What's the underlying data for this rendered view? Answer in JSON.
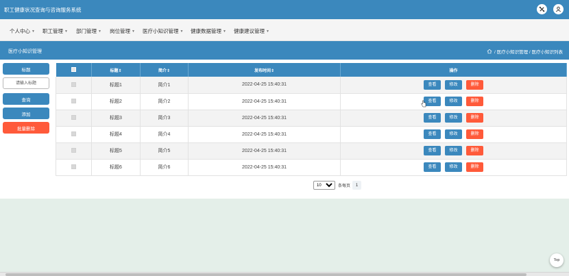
{
  "app": {
    "title": "职工健康状况查询与咨询服务系统"
  },
  "topbar": {
    "icons": [
      "settings-tool-icon",
      "user-icon"
    ]
  },
  "nav": {
    "items": [
      {
        "label": "个人中心"
      },
      {
        "label": "职工管理"
      },
      {
        "label": "部门管理"
      },
      {
        "label": "岗位管理"
      },
      {
        "label": "医疗小知识管理"
      },
      {
        "label": "健康数据管理"
      },
      {
        "label": "健康建议管理"
      }
    ]
  },
  "subheader": {
    "title": "医疗小知识管理",
    "breadcrumb": " / 医疗小知识管理 / 医疗小知识列表"
  },
  "sidebar": {
    "field_label": "标题",
    "input_placeholder": "请输入标题",
    "query_label": "查询",
    "add_label": "添加",
    "batch_delete_label": "批量删除"
  },
  "table": {
    "headers": {
      "title": "标题⇕",
      "summary": "简介⇕",
      "publish_time": "发布时间⇕",
      "actions": "操作"
    },
    "rows": [
      {
        "title": "标题1",
        "summary": "简介1",
        "publish_time": "2022-04-25 15:40:31"
      },
      {
        "title": "标题2",
        "summary": "简介2",
        "publish_time": "2022-04-25 15:40:31"
      },
      {
        "title": "标题3",
        "summary": "简介3",
        "publish_time": "2022-04-25 15:40:31"
      },
      {
        "title": "标题4",
        "summary": "简介4",
        "publish_time": "2022-04-25 15:40:31"
      },
      {
        "title": "标题5",
        "summary": "简介5",
        "publish_time": "2022-04-25 15:40:31"
      },
      {
        "title": "标题6",
        "summary": "简介6",
        "publish_time": "2022-04-25 15:40:31"
      }
    ],
    "action_labels": {
      "view": "查看",
      "edit": "修改",
      "delete": "删除"
    }
  },
  "pagination": {
    "page_size_options": [
      "10"
    ],
    "page_size": "10",
    "per_page_label": "条每页",
    "current_page": "1"
  },
  "back_to_top": {
    "label": "Top"
  },
  "colors": {
    "primary": "#3b88bd",
    "danger": "#ff5a3a",
    "page_bg": "#e4efe9"
  }
}
